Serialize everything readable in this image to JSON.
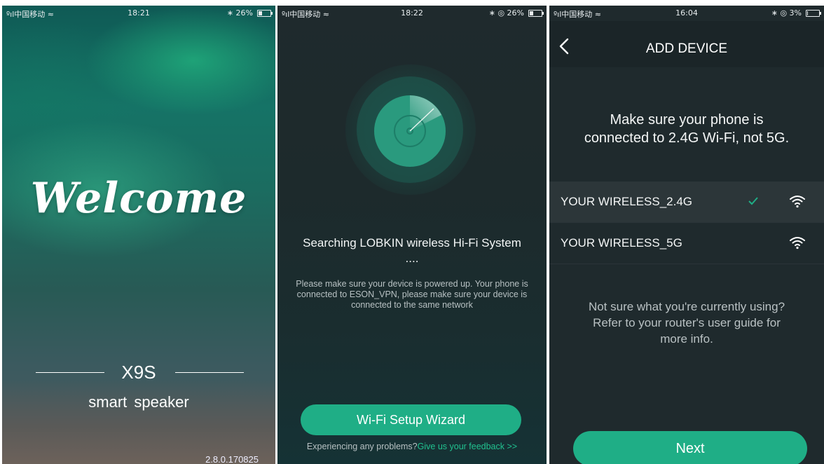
{
  "screens": [
    {
      "status_bar": {
        "carrier": "ºıl中国移动 ≈",
        "time": "18:21",
        "right": "∗ 26%",
        "battery_level": 0.26
      },
      "welcome": "Welcome",
      "model": "X9S",
      "tagline": "smart speaker",
      "version": "2.8.0.170825"
    },
    {
      "status_bar": {
        "carrier": "ºıl中国移动 ≈",
        "time": "18:22",
        "right": "∗ ◎ 26%",
        "battery_level": 0.26
      },
      "search_title": "Searching LOBKIN wireless Hi-Fi System ....",
      "hint": "Please make sure your device is powered up. Your phone is connected to ESON_VPN, please make sure your device is connected to the same network",
      "wizard_button": "Wi-Fi Setup Wizard",
      "feedback_prefix": "Experiencing any problems?",
      "feedback_link": "Give us your feedback >>"
    },
    {
      "status_bar": {
        "carrier": "ºıl中国移动 ≈",
        "time": "16:04",
        "right": "∗ ◎ 3%",
        "battery_level": 0.03
      },
      "title": "ADD DEVICE",
      "notice": "Make sure your phone is connected to 2.4G Wi-Fi, not 5G.",
      "networks": [
        {
          "name": "YOUR WIRELESS_2.4G",
          "selected": true
        },
        {
          "name": "YOUR WIRELESS_5G",
          "selected": false
        }
      ],
      "help": "Not sure what you're currently using? Refer to your router's user guide for more info.",
      "next_button": "Next"
    }
  ],
  "colors": {
    "accent": "#1fae86",
    "link": "#21c18f",
    "dark_bg": "#1f2a2d"
  },
  "icons": [
    "signal-icon",
    "wifi-status-icon",
    "bluetooth-icon",
    "location-icon",
    "battery-icon",
    "radar-icon",
    "back-arrow-icon",
    "check-icon",
    "wifi-icon"
  ]
}
